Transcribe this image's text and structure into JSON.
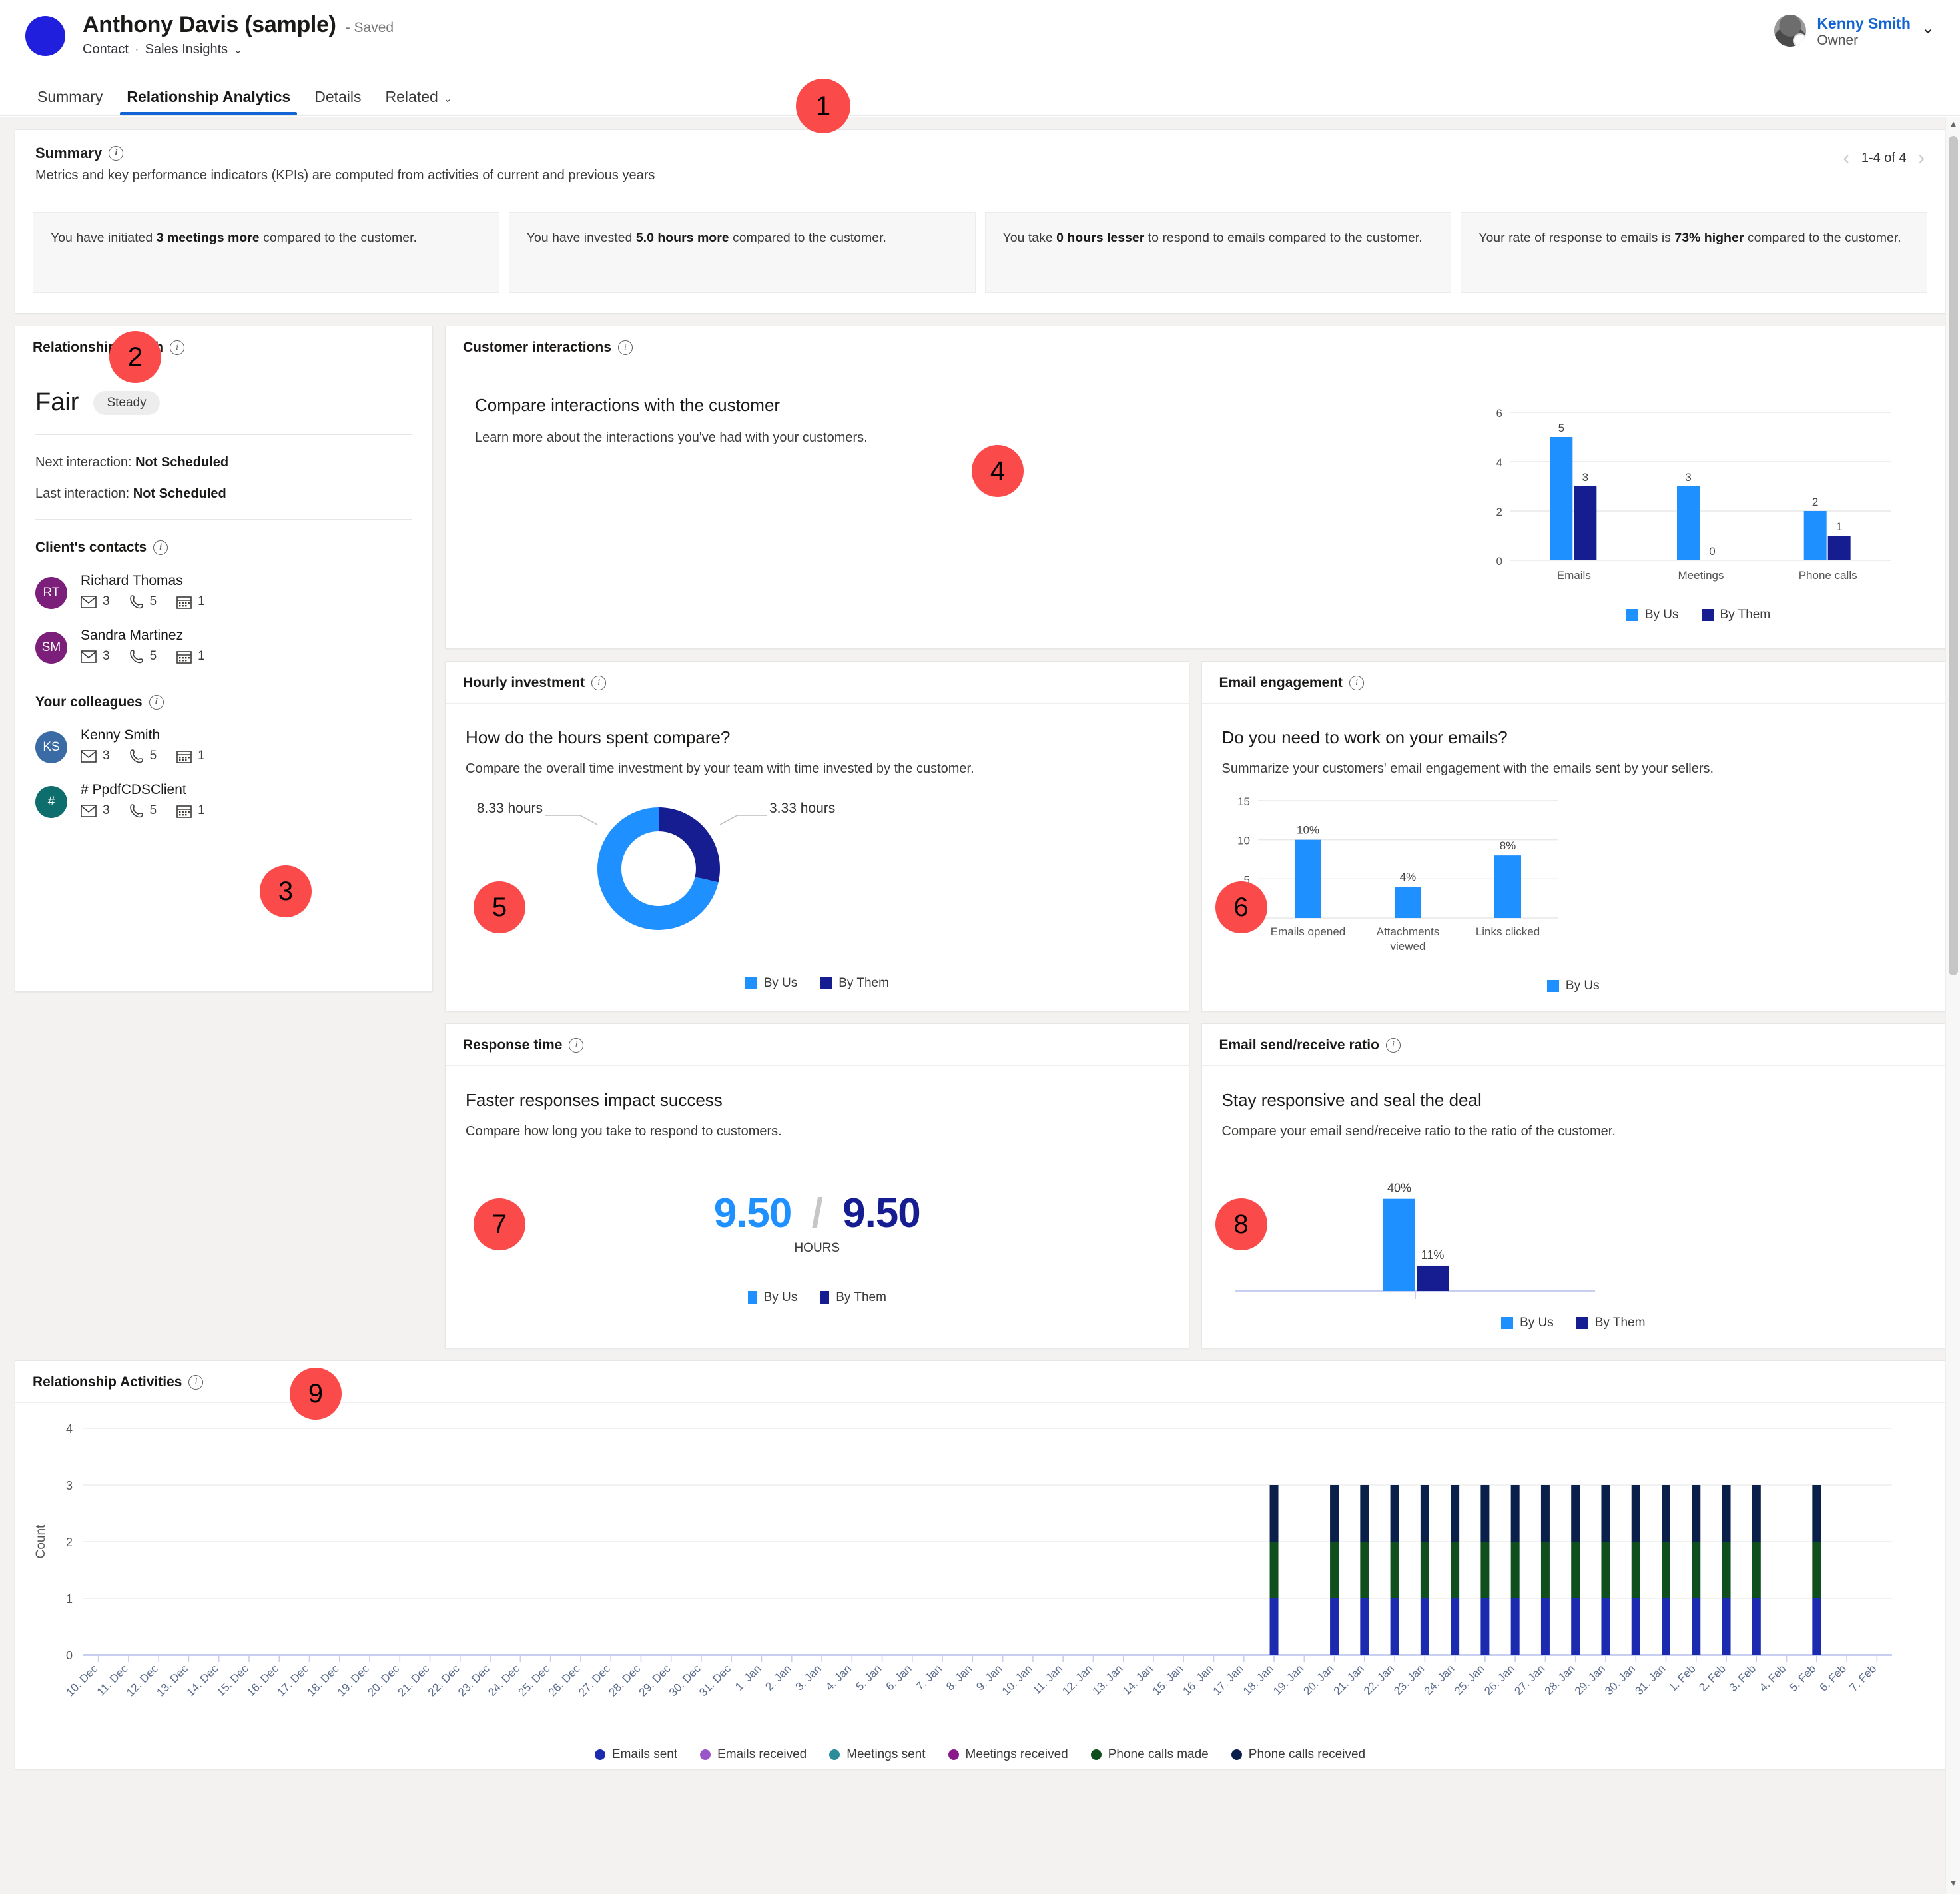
{
  "header": {
    "record_name": "Anthony Davis (sample)",
    "saved_state": "- Saved",
    "entity_type": "Contact",
    "separator": "·",
    "app_name": "Sales Insights",
    "chevron": "⌄",
    "user_name": "Kenny Smith",
    "user_role": "Owner",
    "user_chevron": "⌄"
  },
  "tabs": [
    {
      "label": "Summary",
      "active": false
    },
    {
      "label": "Relationship Analytics",
      "active": true
    },
    {
      "label": "Details",
      "active": false
    },
    {
      "label": "Related",
      "active": false,
      "chevron": "⌄"
    }
  ],
  "summary": {
    "title": "Summary",
    "subtitle": "Metrics and key performance indicators (KPIs) are computed from activities of current and previous years",
    "pager": {
      "prev": "‹",
      "label": "1-4 of 4",
      "next": "›"
    },
    "kpis": [
      {
        "pre": "You have initiated ",
        "strong": "3 meetings more",
        "post": " compared to the customer."
      },
      {
        "pre": "You have invested ",
        "strong": "5.0 hours more",
        "post": " compared to the customer."
      },
      {
        "pre": "You take ",
        "strong": "0 hours lesser",
        "post": " to respond to emails compared to the customer."
      },
      {
        "pre": "Your rate of response to emails is ",
        "strong": "73% higher",
        "post": " compared to the customer."
      }
    ]
  },
  "relationship_health": {
    "title": "Relationship Health",
    "grade": "Fair",
    "trend": "Steady",
    "next_label": "Next interaction:",
    "next_value": "Not Scheduled",
    "last_label": "Last interaction:",
    "last_value": "Not Scheduled",
    "clients_title": "Client's contacts",
    "clients": [
      {
        "initials": "RT",
        "name": "Richard Thomas",
        "color": "#7b1f7b",
        "emails": "3",
        "calls": "5",
        "meetings": "1"
      },
      {
        "initials": "SM",
        "name": "Sandra Martinez",
        "color": "#7b1f7b",
        "emails": "3",
        "calls": "5",
        "meetings": "1"
      }
    ],
    "colleagues_title": "Your colleagues",
    "colleagues": [
      {
        "initials": "KS",
        "name": "Kenny Smith",
        "color": "#3a6ba5",
        "emails": "3",
        "calls": "5",
        "meetings": "1"
      },
      {
        "initials": "#",
        "name": "# PpdfCDSClient",
        "color": "#0e6e6e",
        "emails": "3",
        "calls": "5",
        "meetings": "1"
      }
    ]
  },
  "customer_interactions": {
    "title": "Customer interactions",
    "heading": "Compare interactions with the customer",
    "paragraph": "Learn more about the interactions you've had with your customers."
  },
  "hourly_investment": {
    "title": "Hourly investment",
    "heading": "How do the hours spent compare?",
    "paragraph": "Compare the overall time investment by your team with time invested by the customer."
  },
  "email_engagement": {
    "title": "Email engagement",
    "heading": "Do you need to work on your emails?",
    "paragraph": "Summarize your customers' email engagement with the emails sent by your sellers."
  },
  "response_time": {
    "title": "Response time",
    "heading": "Faster responses impact success",
    "paragraph": "Compare how long you take to respond to customers.",
    "value_us": "9.50",
    "separator": "/",
    "value_them": "9.50",
    "unit": "HOURS",
    "legend": [
      "By Us",
      "By Them"
    ]
  },
  "email_ratio": {
    "title": "Email send/receive ratio",
    "heading": "Stay responsive and seal the deal",
    "paragraph": "Compare your email send/receive ratio to the ratio of the customer."
  },
  "relationship_activities": {
    "title": "Relationship Activities"
  },
  "colors": {
    "by_us": "#1e90ff",
    "by_them": "#151d91",
    "accent": "#1264d4",
    "badge": "#fb4a4a",
    "emails_sent": "#1c2ab0",
    "emails_received": "#9a55c9",
    "meetings_sent": "#2a8d99",
    "meetings_received": "#8a1a8a",
    "phone_calls_made": "#0f4f1e",
    "phone_calls_received": "#0a1f49"
  },
  "badges": [
    "1",
    "2",
    "3",
    "4",
    "5",
    "6",
    "7",
    "8",
    "9"
  ],
  "chart_data": [
    {
      "id": "customer-interactions",
      "type": "bar",
      "title": "",
      "categories": [
        "Emails",
        "Meetings",
        "Phone calls"
      ],
      "series": [
        {
          "name": "By Us",
          "color": "#1e90ff",
          "values": [
            5,
            3,
            2
          ]
        },
        {
          "name": "By Them",
          "color": "#151d91",
          "values": [
            3,
            0,
            1
          ]
        }
      ],
      "yticks": [
        0,
        2,
        4,
        6
      ],
      "ylim": [
        0,
        6
      ],
      "grid": true,
      "legend_position": "bottom"
    },
    {
      "id": "hourly-investment",
      "type": "pie",
      "title": "",
      "labels": [
        "8.33 hours",
        "3.33 hours"
      ],
      "slices": [
        {
          "name": "By Us",
          "value": 8.33,
          "label": "8.33 hours",
          "color": "#1e90ff"
        },
        {
          "name": "By Them",
          "value": 3.33,
          "label": "3.33 hours",
          "color": "#151d91"
        }
      ],
      "legend_position": "bottom"
    },
    {
      "id": "email-engagement",
      "type": "bar",
      "title": "",
      "categories": [
        "Emails opened",
        "Attachments viewed",
        "Links clicked"
      ],
      "series": [
        {
          "name": "By Us",
          "color": "#1e90ff",
          "values": [
            10,
            4,
            8
          ],
          "labels": [
            "10%",
            "4%",
            "8%"
          ]
        }
      ],
      "yticks": [
        0,
        5,
        10,
        15
      ],
      "ylim": [
        0,
        15
      ],
      "grid": true,
      "legend_position": "bottom"
    },
    {
      "id": "email-send-receive-ratio",
      "type": "bar",
      "title": "",
      "categories": [
        ""
      ],
      "series": [
        {
          "name": "By Us",
          "color": "#1e90ff",
          "values": [
            40
          ],
          "labels": [
            "40%"
          ]
        },
        {
          "name": "By Them",
          "color": "#151d91",
          "values": [
            11
          ],
          "labels": [
            "11%"
          ]
        }
      ],
      "ylim": [
        0,
        48
      ],
      "grid": false,
      "legend_position": "bottom"
    },
    {
      "id": "relationship-activities",
      "type": "bar",
      "stacked": true,
      "title": "Relationship Activities",
      "ylabel": "Count",
      "yticks": [
        0,
        1,
        2,
        3,
        4
      ],
      "ylim": [
        0,
        4
      ],
      "grid": true,
      "legend_position": "bottom",
      "categories": [
        "10. Dec",
        "11. Dec",
        "12. Dec",
        "13. Dec",
        "14. Dec",
        "15. Dec",
        "16. Dec",
        "17. Dec",
        "18. Dec",
        "19. Dec",
        "20. Dec",
        "21. Dec",
        "22. Dec",
        "23. Dec",
        "24. Dec",
        "25. Dec",
        "26. Dec",
        "27. Dec",
        "28. Dec",
        "29. Dec",
        "30. Dec",
        "31. Dec",
        "1. Jan",
        "2. Jan",
        "3. Jan",
        "4. Jan",
        "5. Jan",
        "6. Jan",
        "7. Jan",
        "8. Jan",
        "9. Jan",
        "10. Jan",
        "11. Jan",
        "12. Jan",
        "13. Jan",
        "14. Jan",
        "15. Jan",
        "16. Jan",
        "17. Jan",
        "18. Jan",
        "19. Jan",
        "20. Jan",
        "21. Jan",
        "22. Jan",
        "23. Jan",
        "24. Jan",
        "25. Jan",
        "26. Jan",
        "27. Jan",
        "28. Jan",
        "29. Jan",
        "30. Jan",
        "31. Jan",
        "1. Feb",
        "2. Feb",
        "3. Feb",
        "4. Feb",
        "5. Feb",
        "6. Feb",
        "7. Feb"
      ],
      "series": [
        {
          "name": "Emails sent",
          "color": "#1c2ab0",
          "values": [
            0,
            0,
            0,
            0,
            0,
            0,
            0,
            0,
            0,
            0,
            0,
            0,
            0,
            0,
            0,
            0,
            0,
            0,
            0,
            0,
            0,
            0,
            0,
            0,
            0,
            0,
            0,
            0,
            0,
            0,
            0,
            0,
            0,
            0,
            0,
            0,
            0,
            0,
            0,
            1,
            0,
            1,
            1,
            1,
            1,
            1,
            1,
            1,
            1,
            1,
            1,
            1,
            1,
            1,
            1,
            1,
            0,
            1,
            0,
            0
          ]
        },
        {
          "name": "Emails received",
          "color": "#9a55c9",
          "values": [
            0,
            0,
            0,
            0,
            0,
            0,
            0,
            0,
            0,
            0,
            0,
            0,
            0,
            0,
            0,
            0,
            0,
            0,
            0,
            0,
            0,
            0,
            0,
            0,
            0,
            0,
            0,
            0,
            0,
            0,
            0,
            0,
            0,
            0,
            0,
            0,
            0,
            0,
            0,
            0,
            0,
            0,
            0,
            0,
            0,
            0,
            0,
            0,
            0,
            0,
            0,
            0,
            0,
            0,
            0,
            0,
            0,
            0,
            0,
            0
          ]
        },
        {
          "name": "Meetings sent",
          "color": "#2a8d99",
          "values": [
            0,
            0,
            0,
            0,
            0,
            0,
            0,
            0,
            0,
            0,
            0,
            0,
            0,
            0,
            0,
            0,
            0,
            0,
            0,
            0,
            0,
            0,
            0,
            0,
            0,
            0,
            0,
            0,
            0,
            0,
            0,
            0,
            0,
            0,
            0,
            0,
            0,
            0,
            0,
            0,
            0,
            0,
            0,
            0,
            0,
            0,
            0,
            0,
            0,
            0,
            0,
            0,
            0,
            0,
            0,
            0,
            0,
            0,
            0,
            0
          ]
        },
        {
          "name": "Meetings received",
          "color": "#8a1a8a",
          "values": [
            0,
            0,
            0,
            0,
            0,
            0,
            0,
            0,
            0,
            0,
            0,
            0,
            0,
            0,
            0,
            0,
            0,
            0,
            0,
            0,
            0,
            0,
            0,
            0,
            0,
            0,
            0,
            0,
            0,
            0,
            0,
            0,
            0,
            0,
            0,
            0,
            0,
            0,
            0,
            0,
            0,
            0,
            0,
            0,
            0,
            0,
            0,
            0,
            0,
            0,
            0,
            0,
            0,
            0,
            0,
            0,
            0,
            0,
            0,
            0
          ]
        },
        {
          "name": "Phone calls made",
          "color": "#0f4f1e",
          "values": [
            0,
            0,
            0,
            0,
            0,
            0,
            0,
            0,
            0,
            0,
            0,
            0,
            0,
            0,
            0,
            0,
            0,
            0,
            0,
            0,
            0,
            0,
            0,
            0,
            0,
            0,
            0,
            0,
            0,
            0,
            0,
            0,
            0,
            0,
            0,
            0,
            0,
            0,
            0,
            1,
            0,
            1,
            1,
            1,
            1,
            1,
            1,
            1,
            1,
            1,
            1,
            1,
            1,
            1,
            1,
            1,
            0,
            1,
            0,
            0
          ]
        },
        {
          "name": "Phone calls received",
          "color": "#0a1f49",
          "values": [
            0,
            0,
            0,
            0,
            0,
            0,
            0,
            0,
            0,
            0,
            0,
            0,
            0,
            0,
            0,
            0,
            0,
            0,
            0,
            0,
            0,
            0,
            0,
            0,
            0,
            0,
            0,
            0,
            0,
            0,
            0,
            0,
            0,
            0,
            0,
            0,
            0,
            0,
            0,
            1,
            0,
            1,
            1,
            1,
            1,
            1,
            1,
            1,
            1,
            1,
            1,
            1,
            1,
            1,
            1,
            1,
            0,
            1,
            0,
            0
          ]
        }
      ]
    }
  ]
}
